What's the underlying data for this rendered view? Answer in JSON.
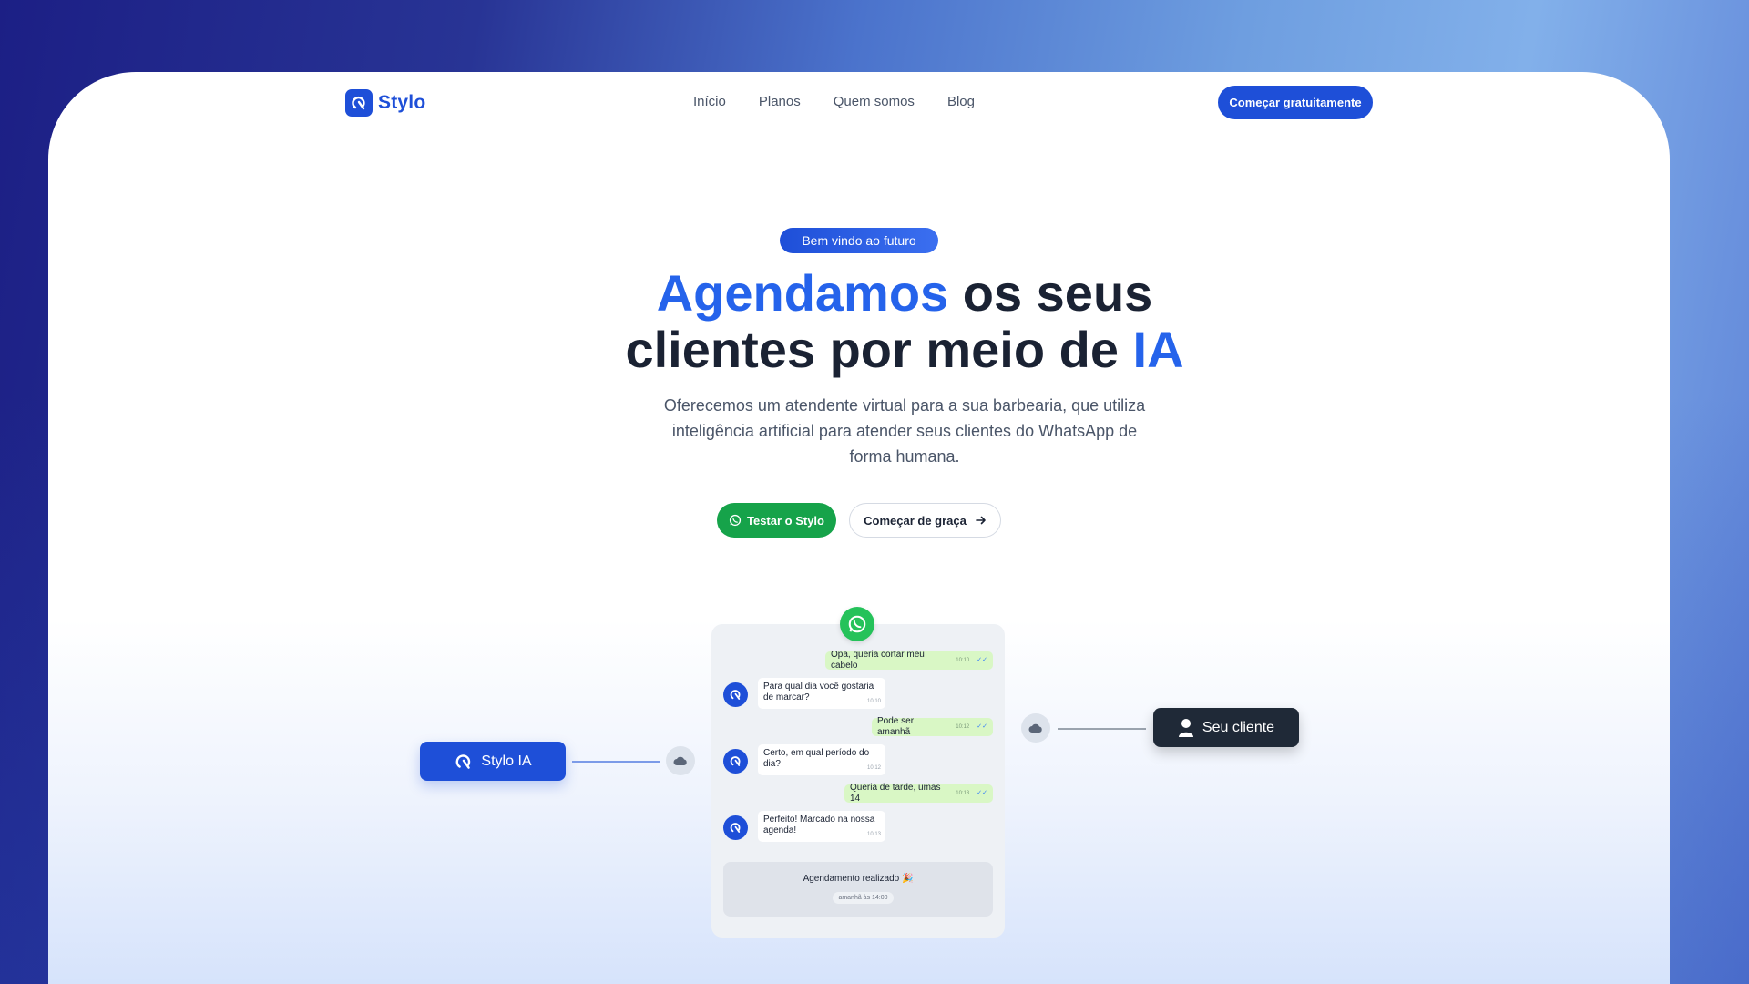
{
  "brand": {
    "name": "Stylo",
    "color": "#1e4fd8"
  },
  "nav": {
    "items": [
      "Início",
      "Planos",
      "Quem somos",
      "Blog"
    ],
    "cta": "Começar gratuitamente"
  },
  "hero": {
    "badge": "Bem vindo ao futuro",
    "title_part1": "Agendamos",
    "title_part2": " os seus",
    "title_part3": "clientes por meio de ",
    "title_part4": "IA",
    "subtitle": "Oferecemos um atendente virtual para a sua barbearia, que utiliza inteligência artificial para atender seus clientes do WhatsApp de forma humana.",
    "btn_primary": "Testar o Stylo",
    "btn_secondary": "Começar de graça"
  },
  "chat": {
    "messages": [
      {
        "from": "client",
        "text": "Opa, queria cortar meu cabelo",
        "time": "10:10"
      },
      {
        "from": "bot",
        "text": "Para qual dia você gostaria de marcar?",
        "time": "10:10"
      },
      {
        "from": "client",
        "text": "Pode ser amanhã",
        "time": "10:12"
      },
      {
        "from": "bot",
        "text": "Certo, em qual período do dia?",
        "time": "10:12"
      },
      {
        "from": "client",
        "text": "Queria de tarde, umas 14",
        "time": "10:13"
      },
      {
        "from": "bot",
        "text": "Perfeito! Marcado na nossa agenda!",
        "time": "10:13"
      }
    ],
    "confirmation": "Agendamento realizado 🎉",
    "confirmation_time": "amanhã às 14:00"
  },
  "nodes": {
    "left": "Stylo IA",
    "right": "Seu cliente"
  },
  "colors": {
    "accent": "#2563eb",
    "whatsapp": "#16a34a",
    "dark": "#1f2937"
  }
}
